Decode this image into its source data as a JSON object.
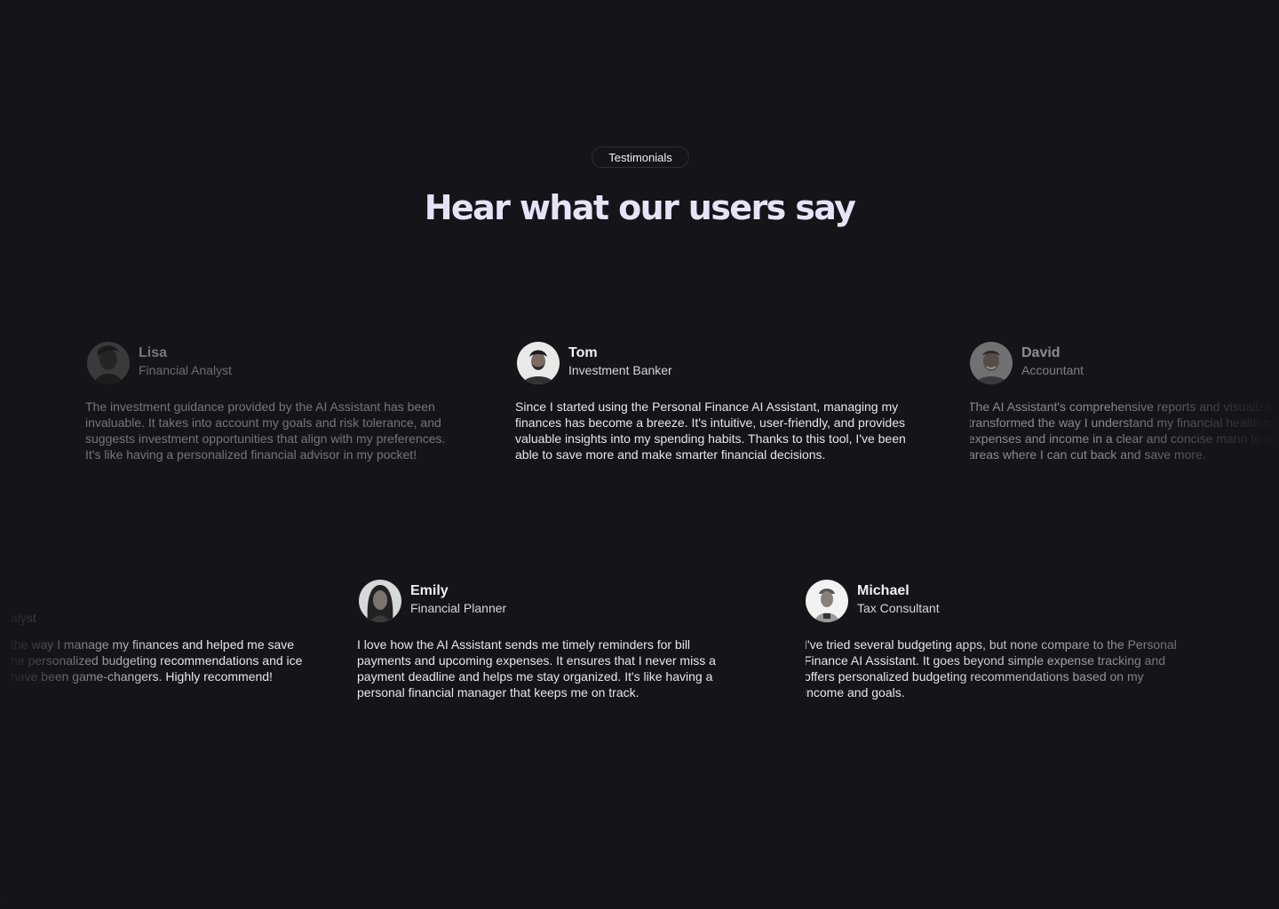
{
  "badge": {
    "label": "Testimonials"
  },
  "headline": "Hear what our users say",
  "testimonials": {
    "lisa": {
      "name": "Lisa",
      "role": "Financial Analyst",
      "quote": "The investment guidance provided by the AI Assistant has been invaluable. It takes into account my goals and risk tolerance, and suggests investment opportunities that align with my preferences. It's like having a personalized financial advisor in my pocket!"
    },
    "tom": {
      "name": "Tom",
      "role": "Investment Banker",
      "quote": "Since I started using the Personal Finance AI Assistant, managing my finances has become a breeze. It's intuitive, user-friendly, and provides valuable insights into my spending habits. Thanks to this tool, I've been able to save more and make smarter financial decisions."
    },
    "david": {
      "name": "David",
      "role": "Accountant",
      "quote": "The AI Assistant's comprehensive reports and visualiza transformed the way I understand my financial health my expenses and income in a clear and concise mann to identify areas where I can cut back and save more."
    },
    "partial": {
      "role": "alyst",
      "quote": "the way I manage my finances and helped me save he personalized budgeting recommendations and ice have been game-changers. Highly recommend!"
    },
    "emily": {
      "name": "Emily",
      "role": "Financial Planner",
      "quote": "I love how the AI Assistant sends me timely reminders for bill payments and upcoming expenses. It ensures that I never miss a payment deadline and helps me stay organized. It's like having a personal financial manager that keeps me on track."
    },
    "michael": {
      "name": "Michael",
      "role": "Tax Consultant",
      "quote": "I've tried several budgeting apps, but none compare to the Personal Finance AI Assistant. It goes beyond simple expense tracking and offers personalized budgeting recommendations based on my income and goals."
    }
  },
  "colors": {
    "background": "#141419",
    "headline": "#e7e3f7",
    "text": "#e6e6ec"
  }
}
